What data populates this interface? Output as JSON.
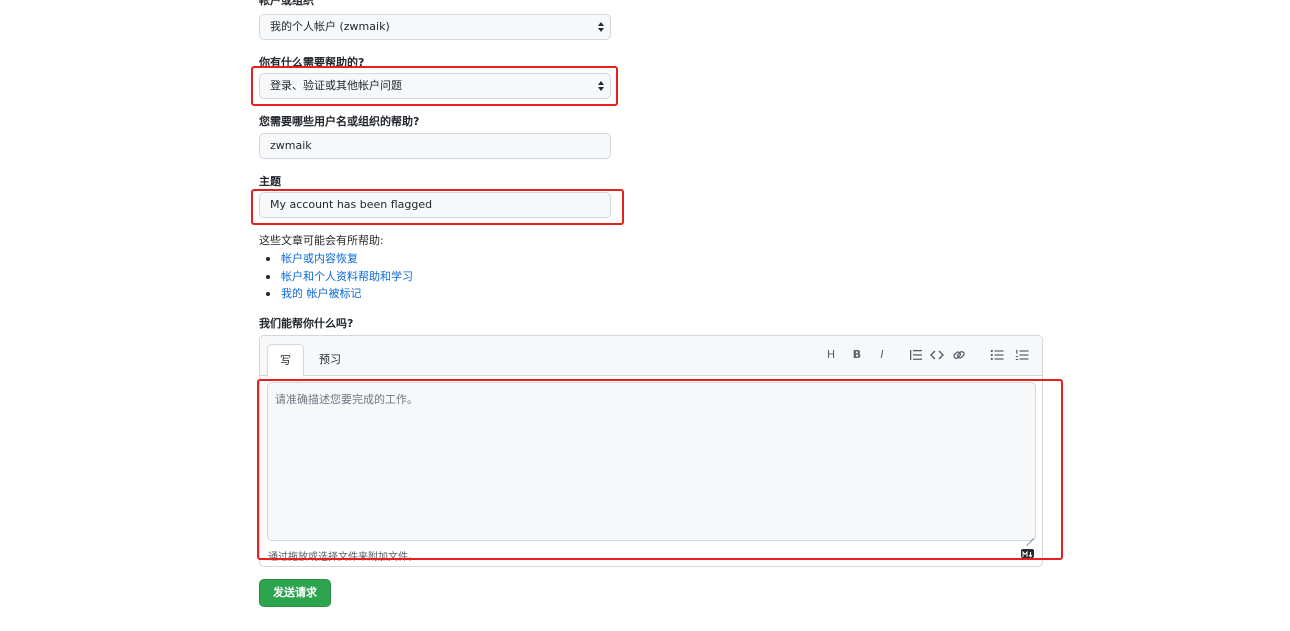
{
  "form": {
    "account_label": "帐户或组织",
    "account_value": "我的个人帐户 (zwmaik)",
    "help_label": "你有什么需要帮助的?",
    "help_value": "登录、验证或其他帐户问题",
    "username_label": "您需要哪些用户名或组织的帮助?",
    "username_value": "zwmaik",
    "subject_label": "主题",
    "subject_value": "My account has been flagged",
    "articles_intro": "这些文章可能会有所帮助:",
    "articles": [
      "帐户或内容恢复",
      "帐户和个人资料帮助和学习",
      "我的 帐户被标记"
    ],
    "message_label": "我们能帮你什么吗?",
    "editor": {
      "tab_write": "写",
      "tab_preview": "预习",
      "placeholder": "请准确描述您要完成的工作。",
      "attach_hint": "通过拖放或选择文件来附加文件。",
      "toolbar": {
        "heading": "H",
        "bold": "B",
        "italic": "I"
      }
    },
    "submit_label": "发送请求"
  },
  "colors": {
    "highlight": "#e3211d",
    "link": "#0969da",
    "submit": "#2da44e"
  },
  "icons": [
    "heading-icon",
    "bold-icon",
    "italic-icon",
    "quote-icon",
    "code-icon",
    "link-icon",
    "unordered-list-icon",
    "ordered-list-icon",
    "markdown-icon",
    "select-caret-icon"
  ]
}
